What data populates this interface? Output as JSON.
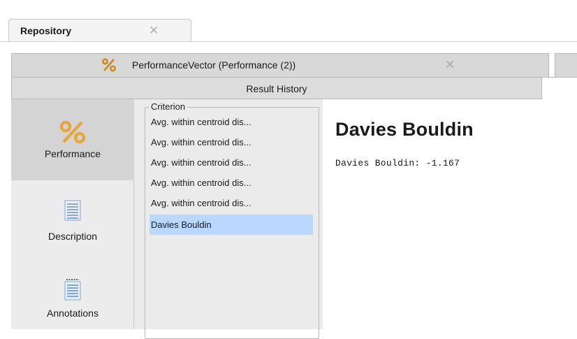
{
  "repository_tab": {
    "label": "Repository",
    "close_glyph": "✕"
  },
  "result_tab": {
    "label": "PerformanceVector (Performance (2))",
    "close_glyph": "✕",
    "icon": "percent-icon"
  },
  "result_history": {
    "label": "Result History"
  },
  "sidebar": {
    "items": [
      {
        "label": "Performance",
        "icon": "percent-icon",
        "selected": true
      },
      {
        "label": "Description",
        "icon": "document-icon",
        "selected": false
      },
      {
        "label": "Annotations",
        "icon": "notepad-icon",
        "selected": false
      }
    ]
  },
  "criterion": {
    "legend": "Criterion",
    "items": [
      {
        "label": "Avg. within centroid dis...",
        "selected": false
      },
      {
        "label": "Avg. within centroid dis...",
        "selected": false
      },
      {
        "label": "Avg. within centroid dis...",
        "selected": false
      },
      {
        "label": "Avg. within centroid dis...",
        "selected": false
      },
      {
        "label": "Avg. within centroid dis...",
        "selected": false
      },
      {
        "label": "Davies Bouldin",
        "selected": true
      }
    ]
  },
  "main": {
    "title": "Davies Bouldin",
    "value_text": "Davies Bouldin: -1.167"
  },
  "colors": {
    "selection": "#b8d8ff",
    "percent_icon": "#e8a640",
    "icon_blue": "#5a8fd6"
  }
}
